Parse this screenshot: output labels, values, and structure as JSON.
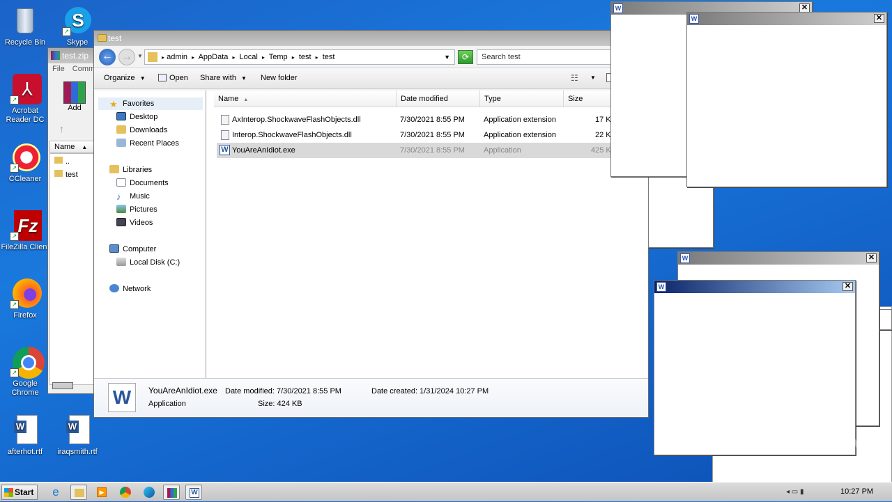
{
  "desktop": {
    "icons": [
      {
        "label": "Recycle Bin",
        "icon": "recycle-bin-icon"
      },
      {
        "label": "Skype",
        "icon": "skype-icon"
      },
      {
        "label": "Acrobat Reader DC",
        "icon": "acrobat-icon"
      },
      {
        "label": "CCleaner",
        "icon": "ccleaner-icon"
      },
      {
        "label": "FileZilla Client",
        "icon": "filezilla-icon"
      },
      {
        "label": "Firefox",
        "icon": "firefox-icon"
      },
      {
        "label": "Google Chrome",
        "icon": "chrome-icon"
      },
      {
        "label": "afterhot.rtf",
        "icon": "word-doc-icon"
      },
      {
        "label": "iraqsmith.rtf",
        "icon": "word-doc-icon"
      }
    ]
  },
  "winrar": {
    "title": "test.zip",
    "menu": [
      "File",
      "Comm"
    ],
    "add_label": "Add",
    "col_name": "Name",
    "rows": [
      "..",
      "test"
    ]
  },
  "explorer": {
    "title": "test",
    "breadcrumb": [
      "admin",
      "AppData",
      "Local",
      "Temp",
      "test",
      "test"
    ],
    "search_placeholder": "Search test",
    "toolbar": {
      "organize": "Organize",
      "open": "Open",
      "share": "Share with",
      "new_folder": "New folder"
    },
    "nav": {
      "favorites": "Favorites",
      "desktop": "Desktop",
      "downloads": "Downloads",
      "recent": "Recent Places",
      "libraries": "Libraries",
      "documents": "Documents",
      "music": "Music",
      "pictures": "Pictures",
      "videos": "Videos",
      "computer": "Computer",
      "local_disk": "Local Disk (C:)",
      "network": "Network"
    },
    "columns": {
      "name": "Name",
      "date": "Date modified",
      "type": "Type",
      "size": "Size"
    },
    "files": [
      {
        "name": "AxInterop.ShockwaveFlashObjects.dll",
        "date": "7/30/2021 8:55 PM",
        "type": "Application extension",
        "size": "17 K"
      },
      {
        "name": "Interop.ShockwaveFlashObjects.dll",
        "date": "7/30/2021 8:55 PM",
        "type": "Application extension",
        "size": "22 K"
      },
      {
        "name": "YouAreAnIdiot.exe",
        "date": "7/30/2021 8:55 PM",
        "type": "Application",
        "size": "425 K"
      }
    ],
    "details": {
      "filename": "YouAreAnIdiot.exe",
      "date_modified": "Date modified: 7/30/2021 8:55 PM",
      "date_created": "Date created: 1/31/2024 10:27 PM",
      "type": "Application",
      "size": "Size: 424 KB"
    }
  },
  "taskbar": {
    "start": "Start",
    "clock": "10:27 PM"
  },
  "watermark": "ANY RUN"
}
